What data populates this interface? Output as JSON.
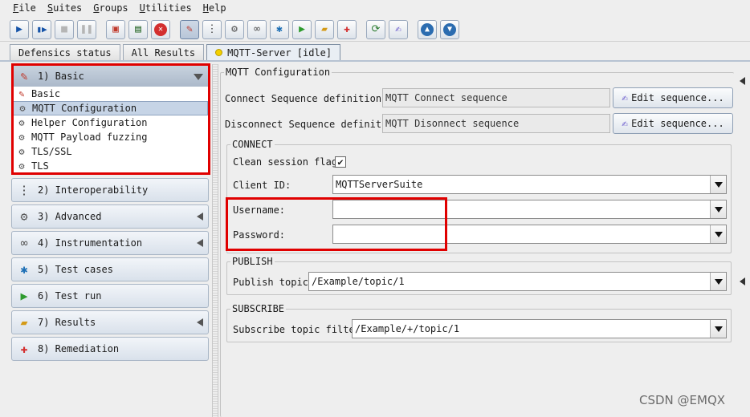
{
  "menu": [
    {
      "mnemonic": "F",
      "rest": "ile"
    },
    {
      "mnemonic": "S",
      "rest": "uites"
    },
    {
      "mnemonic": "G",
      "rest": "roups"
    },
    {
      "mnemonic": "U",
      "rest": "tilities"
    },
    {
      "mnemonic": "H",
      "rest": "elp"
    }
  ],
  "toolbar": {
    "icons": [
      "play-icon",
      "step-icon",
      "stop-icon",
      "pause-icon",
      "open-suite-icon",
      "save-icon",
      "close-suite-icon",
      "edit-icon",
      "traffic-light-icon",
      "interop-icon",
      "instrumentation-icon",
      "test-cases-icon",
      "run-icon",
      "results-folder-icon",
      "remediation-icon",
      "refresh-icon",
      "notes-icon",
      "arrow-up-icon",
      "arrow-down-icon"
    ]
  },
  "tabs": {
    "status": "Defensics status",
    "results": "All Results",
    "server": "MQTT-Server [idle]"
  },
  "nav": {
    "basic": {
      "title": "1) Basic",
      "items": [
        {
          "label": "Basic",
          "icon": "pen-icon"
        },
        {
          "label": "MQTT Configuration",
          "icon": "gear-box-icon"
        },
        {
          "label": "Helper Configuration",
          "icon": "gear-box-icon"
        },
        {
          "label": "MQTT Payload fuzzing",
          "icon": "gear-box-icon"
        },
        {
          "label": "TLS/SSL",
          "icon": "gear-box-icon"
        },
        {
          "label": "TLS",
          "icon": "gear-box-icon"
        }
      ]
    },
    "interop": "2) Interoperability",
    "advanced": "3) Advanced",
    "instrumentation": "4) Instrumentation",
    "testcases": "5) Test cases",
    "testrun": "6) Test run",
    "results": "7) Results",
    "remediation": "8) Remediation"
  },
  "config": {
    "title": "MQTT Configuration",
    "connect_label": "Connect Sequence definition:",
    "connect_value": "MQTT Connect sequence",
    "disconnect_label": "Disconnect Sequence definition:",
    "disconnect_value": "MQTT Disonnect sequence",
    "edit_label": "Edit sequence...",
    "connect_group": "CONNECT",
    "clean_session_label": "Clean session flag:",
    "clean_session_mark": "✔",
    "client_id_label": "Client ID:",
    "client_id_value": "MQTTServerSuite",
    "username_label": "Username:",
    "username_value": "",
    "password_label": "Password:",
    "password_value": "",
    "publish_group": "PUBLISH",
    "publish_topic_label": "Publish topic:",
    "publish_topic_value": "/Example/topic/1",
    "subscribe_group": "SUBSCRIBE",
    "subscribe_filter_label": "Subscribe topic filter:",
    "subscribe_filter_value": "/Example/+/topic/1"
  },
  "watermark": "CSDN @EMQX",
  "colors": {
    "highlight": "#e00000",
    "selected": "#c6d4e6"
  }
}
